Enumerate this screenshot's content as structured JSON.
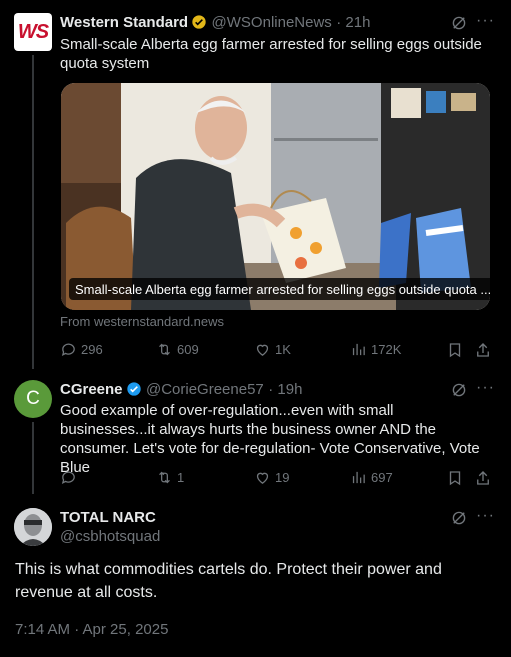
{
  "quoted_tweet": {
    "avatar_text": "WS",
    "author_name": "Western Standard",
    "handle": "@WSOnlineNews",
    "time": "· 21h",
    "text": "Small-scale Alberta egg farmer arrested for selling eggs outside quota system",
    "card_caption": "Small-scale Alberta egg farmer arrested for selling eggs outside quota ...",
    "card_source": "From westernstandard.news",
    "replies": "296",
    "retweets": "609",
    "likes": "1K",
    "views": "172K"
  },
  "reply_tweet": {
    "avatar_letter": "C",
    "author_name": "CGreene",
    "handle": "@CorieGreene57",
    "time": "· 19h",
    "text": "Good example of over-regulation...even with small businesses...it always hurts the business owner AND the consumer.  Let's vote for de-regulation- Vote Conservative, Vote Blue",
    "retweets": "1",
    "likes": "19",
    "views": "697"
  },
  "main_tweet": {
    "author_name": "TOTAL NARC",
    "handle": "@csbhotsquad",
    "text": "This is what commodities cartels do.  Protect their power and revenue at all costs.",
    "timestamp": "7:14 AM · Apr 25, 2025"
  },
  "colors": {
    "background": "#000000",
    "text": "#e7e9ea",
    "muted": "#71767b",
    "verified": "#1d9bf0",
    "ws_red": "#c8102e",
    "cgreene_green": "#5a9a3a"
  }
}
